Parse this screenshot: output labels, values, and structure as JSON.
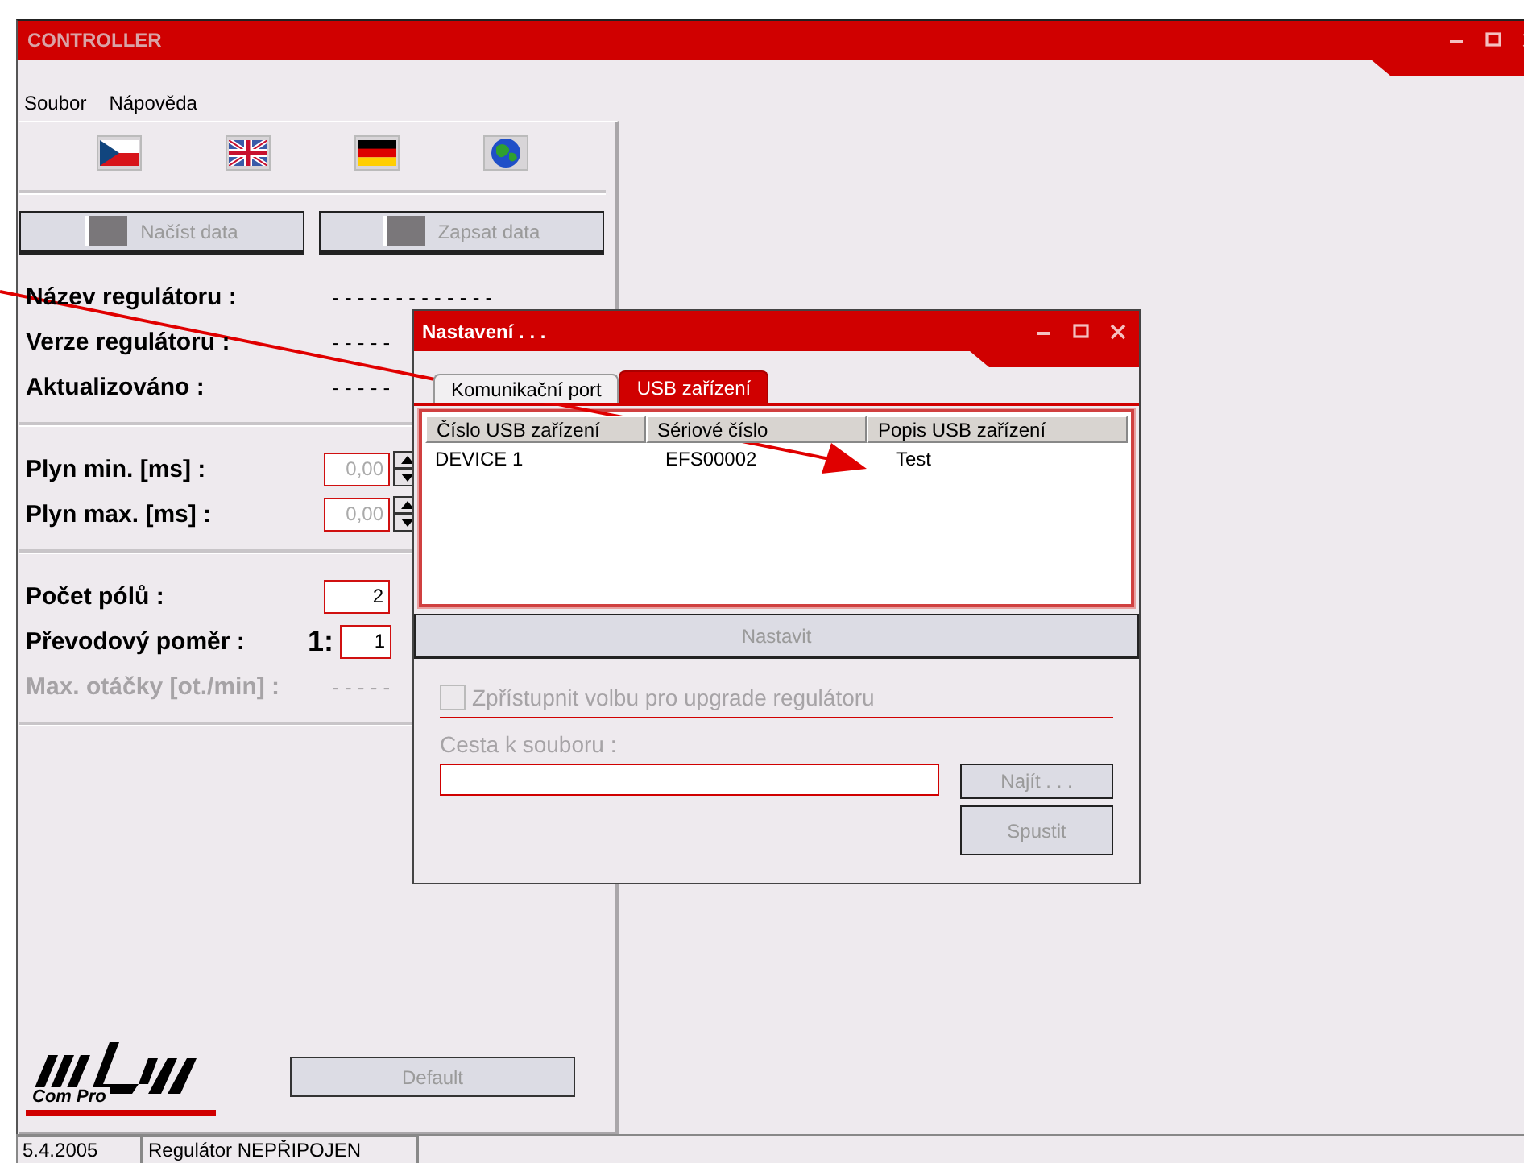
{
  "window": {
    "title": "CONTROLLER"
  },
  "menu": [
    "Soubor",
    "Nápověda"
  ],
  "data_buttons": [
    {
      "label": "Načíst data",
      "disabled": true
    },
    {
      "label": "Zapsat data",
      "disabled": true
    }
  ],
  "info": [
    {
      "label": "Název regulátoru :",
      "value": "- - - - - - - - - - - - -"
    },
    {
      "label": "Verze regulátoru :",
      "value": "- - - - -"
    },
    {
      "label": "Aktualizováno :",
      "value": "- - - - -"
    }
  ],
  "throttle": [
    {
      "label": "Plyn min. [ms] :",
      "value": "0,00",
      "disabled": true
    },
    {
      "label": "Plyn max. [ms] :",
      "value": "0,00",
      "disabled": true
    }
  ],
  "poles": {
    "label": "Počet pólů :",
    "value": "2"
  },
  "ratio": {
    "label": "Převodový poměr :",
    "prefix": "1:",
    "value": "1"
  },
  "max_rpm": {
    "label": "Max. otáčky [ot./min] :",
    "value": "- - - - -",
    "disabled": true
  },
  "default_button": {
    "label": "Default",
    "disabled": true
  },
  "logo": {
    "text": "Com Pro"
  },
  "status_bar": [
    "5.4.2005",
    "Regulátor NEPŘIPOJEN"
  ],
  "dialog": {
    "title": "Nastavení . . .",
    "tabs": [
      {
        "label": "Komunikační port",
        "selected": false
      },
      {
        "label": "USB zařízení",
        "selected": true
      }
    ],
    "table": {
      "columns": [
        "Číslo USB zařízení",
        "Sériové číslo",
        "Popis USB zařízení"
      ],
      "rows": [
        [
          "DEVICE 1",
          "EFS00002",
          "Test"
        ]
      ]
    },
    "set_button": {
      "label": "Nastavit",
      "disabled": true
    },
    "upgrade": {
      "label": "Zpřístupnit volbu pro upgrade regulátoru",
      "checked": false,
      "disabled": true
    },
    "path_label": "Cesta k souboru :",
    "find_button": {
      "label": "Najít . . .",
      "disabled": true
    },
    "run_button": {
      "label": "Spustit",
      "disabled": true
    }
  }
}
